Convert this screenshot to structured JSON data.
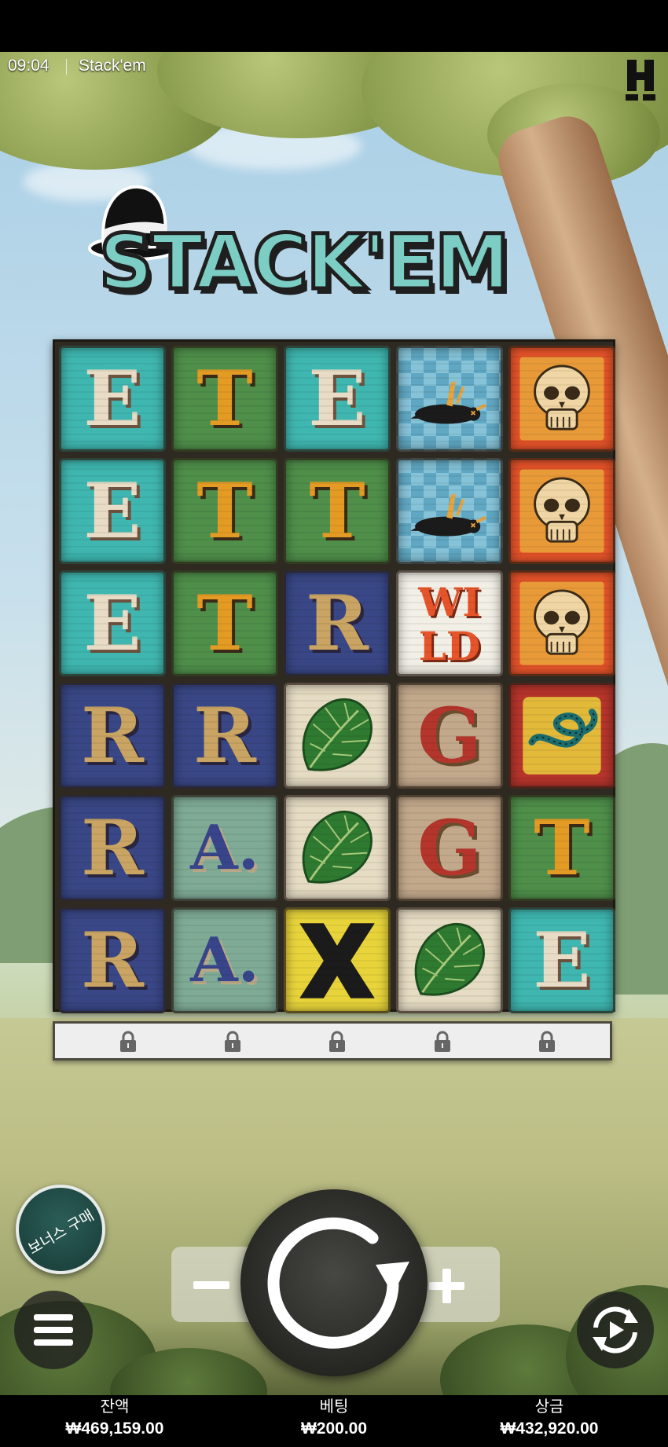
{
  "status_bar": {
    "time": "09:04",
    "app_title": "Stack'em"
  },
  "game": {
    "logo_text": "STACK'EM",
    "grid": [
      [
        "E",
        "T",
        "E",
        "bird",
        "skull"
      ],
      [
        "E",
        "T",
        "T",
        "bird",
        "skull"
      ],
      [
        "E",
        "T",
        "R",
        "wild",
        "skull"
      ],
      [
        "R",
        "R",
        "leaf",
        "G",
        "snake"
      ],
      [
        "R",
        "A.",
        "leaf",
        "G",
        "T"
      ],
      [
        "R",
        "A.",
        "X",
        "leaf",
        "E"
      ]
    ],
    "wild_text": [
      "WI",
      "LD"
    ],
    "locked_columns": 5
  },
  "controls": {
    "bonus_buy_label": "보너스 구매",
    "menu_icon": "hamburger-menu-icon",
    "minus_icon": "minus-icon",
    "spin_icon": "spin-arrow-icon",
    "plus_icon": "plus-icon",
    "autoplay_icon": "autoplay-icon"
  },
  "footer": {
    "balance_label": "잔액",
    "balance_value": "₩469,159.00",
    "bet_label": "베팅",
    "bet_value": "₩200.00",
    "win_label": "상금",
    "win_value": "₩432,920.00"
  },
  "colors": {
    "teal": "#3fb7b0",
    "green": "#4f8f4a",
    "navy": "#394786",
    "orange": "#e8542a",
    "bonus_button": "#1f4a45"
  }
}
